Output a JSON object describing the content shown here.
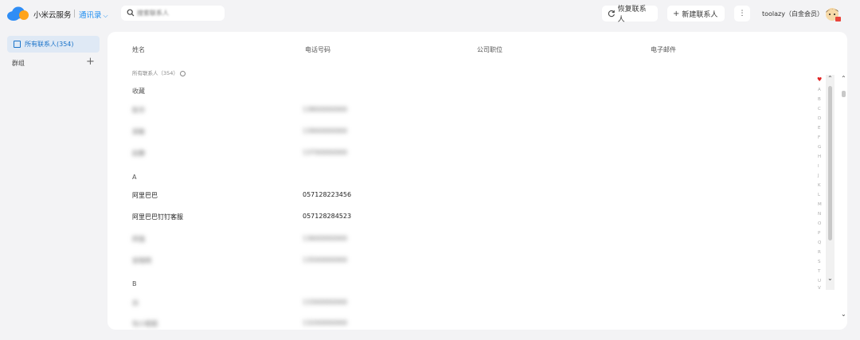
{
  "header": {
    "app_name": "小米云服务",
    "module": "通讯录",
    "module_chevron": "⌵",
    "search_placeholder": "搜索联系人",
    "restore_label": "恢复联系人",
    "new_label": "新建联系人",
    "more_icon": "⋮",
    "user": "toolazy（白金会员）"
  },
  "sidebar": {
    "all_contacts": "所有联系人(354)",
    "groups": "群组",
    "add_icon": "+"
  },
  "table": {
    "columns": [
      "姓名",
      "电话号码",
      "公司职位",
      "电子邮件"
    ],
    "subtitle": "所有联系人（354）"
  },
  "sections": {
    "favorites": {
      "label": "收藏",
      "rows": [
        {
          "name": "陈华",
          "phone": "13800000000"
        },
        {
          "name": "吴敏",
          "phone": "13900000000"
        },
        {
          "name": "赵静",
          "phone": "13700000000"
        }
      ]
    },
    "A": {
      "label": "A",
      "rows": [
        {
          "name": "阿里巴巴",
          "phone": "057128223456"
        },
        {
          "name": "阿里巴巴钉钉客服",
          "phone": "057128284523"
        },
        {
          "name": "阿强",
          "phone": "13600000000"
        },
        {
          "name": "安晓明",
          "phone": "13500000000"
        }
      ]
    },
    "B": {
      "label": "B",
      "rows": [
        {
          "name": "白",
          "phone": "13300000000"
        },
        {
          "name": "包小姐姐",
          "phone": "13200000000"
        }
      ]
    }
  },
  "index": {
    "heart": "♥",
    "letters": [
      "A",
      "B",
      "C",
      "D",
      "E",
      "F",
      "G",
      "H",
      "I",
      "J",
      "K",
      "L",
      "M",
      "N",
      "O",
      "P",
      "Q",
      "R",
      "S",
      "T",
      "U",
      "V"
    ]
  },
  "scroll": {
    "up": "⌃",
    "down": "⌄"
  },
  "colors": {
    "accent": "#1f8ef1",
    "selected_bg": "#dfe9f5",
    "heart": "#e02424"
  }
}
